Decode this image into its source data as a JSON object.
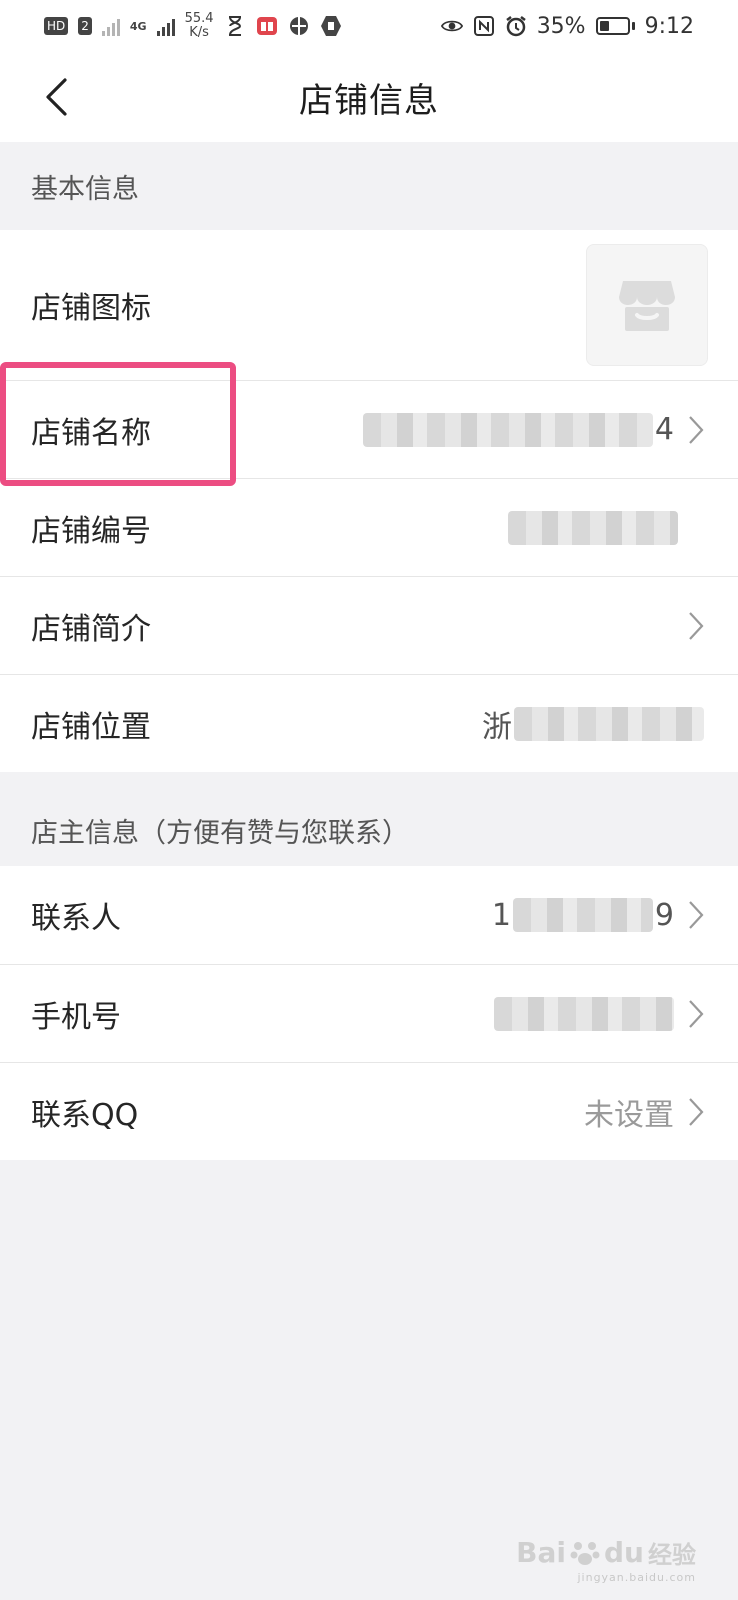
{
  "status_bar": {
    "hd_label": "HD",
    "sim_label": "2",
    "network_type": "4G",
    "net_speed_value": "55.4",
    "net_speed_unit": "K/s",
    "battery_percent": "35%",
    "battery_level": 0.35,
    "time": "9:12",
    "icons": [
      "hourglass-icon",
      "book-app-icon",
      "vpn-icon",
      "shield-app-icon",
      "eye-icon",
      "nfc-icon",
      "alarm-icon",
      "battery-icon"
    ]
  },
  "navbar": {
    "title": "店铺信息",
    "back_icon": "chevron-left-icon"
  },
  "sections": {
    "basic": {
      "header": "基本信息",
      "rows": {
        "logo": {
          "label": "店铺图标"
        },
        "name": {
          "label": "店铺名称",
          "value_suffix": "4"
        },
        "number": {
          "label": "店铺编号"
        },
        "intro": {
          "label": "店铺简介"
        },
        "location": {
          "label": "店铺位置",
          "value_prefix": "浙"
        }
      }
    },
    "owner": {
      "header": "店主信息（方便有赞与您联系）",
      "rows": {
        "contact": {
          "label": "联系人",
          "value_prefix": "1",
          "value_suffix": "9"
        },
        "phone": {
          "label": "手机号"
        },
        "qq": {
          "label": "联系QQ",
          "value": "未设置"
        }
      }
    }
  },
  "watermark": {
    "brand": "Bai",
    "brand2": "du",
    "brand3": "经验",
    "url": "jingyan.baidu.com"
  },
  "colors": {
    "highlight": "#ec4d82",
    "background": "#f2f2f4",
    "card": "#ffffff"
  }
}
